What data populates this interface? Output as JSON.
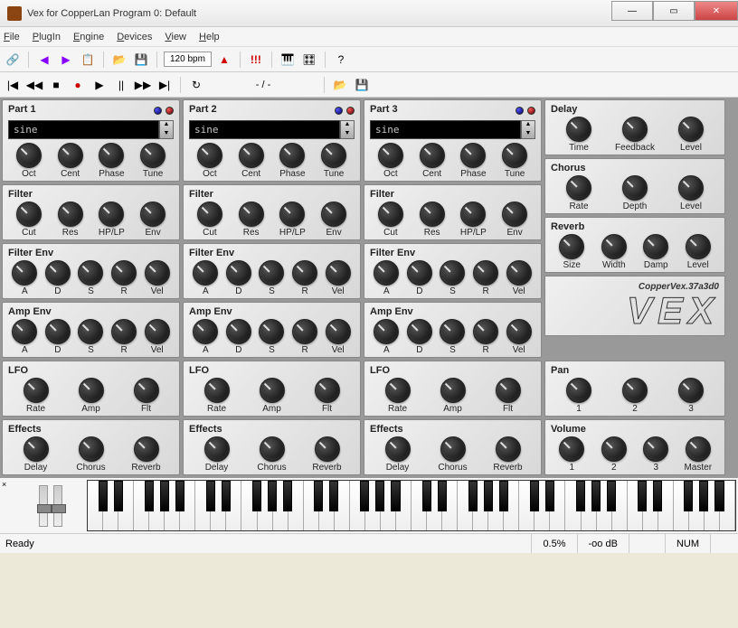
{
  "window": {
    "title": "Vex for CopperLan Program 0: Default"
  },
  "menu": {
    "file": "File",
    "plugin": "PlugIn",
    "engine": "Engine",
    "devices": "Devices",
    "view": "View",
    "help": "Help"
  },
  "toolbar": {
    "tempo": "120 bpm",
    "position": "- / -"
  },
  "parts": [
    {
      "title": "Part 1",
      "wave": "sine",
      "osc": [
        "Oct",
        "Cent",
        "Phase",
        "Tune"
      ],
      "filter_title": "Filter",
      "filter": [
        "Cut",
        "Res",
        "HP/LP",
        "Env"
      ],
      "fenv_title": "Filter Env",
      "fenv": [
        "A",
        "D",
        "S",
        "R",
        "Vel"
      ],
      "aenv_title": "Amp Env",
      "aenv": [
        "A",
        "D",
        "S",
        "R",
        "Vel"
      ],
      "lfo_title": "LFO",
      "lfo": [
        "Rate",
        "Amp",
        "Flt"
      ],
      "fx_title": "Effects",
      "fx": [
        "Delay",
        "Chorus",
        "Reverb"
      ]
    },
    {
      "title": "Part 2",
      "wave": "sine",
      "osc": [
        "Oct",
        "Cent",
        "Phase",
        "Tune"
      ],
      "filter_title": "Filter",
      "filter": [
        "Cut",
        "Res",
        "HP/LP",
        "Env"
      ],
      "fenv_title": "Filter Env",
      "fenv": [
        "A",
        "D",
        "S",
        "R",
        "Vel"
      ],
      "aenv_title": "Amp Env",
      "aenv": [
        "A",
        "D",
        "S",
        "R",
        "Vel"
      ],
      "lfo_title": "LFO",
      "lfo": [
        "Rate",
        "Amp",
        "Flt"
      ],
      "fx_title": "Effects",
      "fx": [
        "Delay",
        "Chorus",
        "Reverb"
      ]
    },
    {
      "title": "Part 3",
      "wave": "sine",
      "osc": [
        "Oct",
        "Cent",
        "Phase",
        "Tune"
      ],
      "filter_title": "Filter",
      "filter": [
        "Cut",
        "Res",
        "HP/LP",
        "Env"
      ],
      "fenv_title": "Filter Env",
      "fenv": [
        "A",
        "D",
        "S",
        "R",
        "Vel"
      ],
      "aenv_title": "Amp Env",
      "aenv": [
        "A",
        "D",
        "S",
        "R",
        "Vel"
      ],
      "lfo_title": "LFO",
      "lfo": [
        "Rate",
        "Amp",
        "Flt"
      ],
      "fx_title": "Effects",
      "fx": [
        "Delay",
        "Chorus",
        "Reverb"
      ]
    }
  ],
  "fx": {
    "delay_title": "Delay",
    "delay": [
      "Time",
      "Feedback",
      "Level"
    ],
    "chorus_title": "Chorus",
    "chorus": [
      "Rate",
      "Depth",
      "Level"
    ],
    "reverb_title": "Reverb",
    "reverb": [
      "Size",
      "Width",
      "Damp",
      "Level"
    ],
    "pan_title": "Pan",
    "pan": [
      "1",
      "2",
      "3"
    ],
    "vol_title": "Volume",
    "vol": [
      "1",
      "2",
      "3",
      "Master"
    ]
  },
  "brand": {
    "small": "CopperVex.37a3d0",
    "big": "VEX"
  },
  "status": {
    "ready": "Ready",
    "cpu": "0.5%",
    "db": "-oo dB",
    "num": "NUM"
  }
}
